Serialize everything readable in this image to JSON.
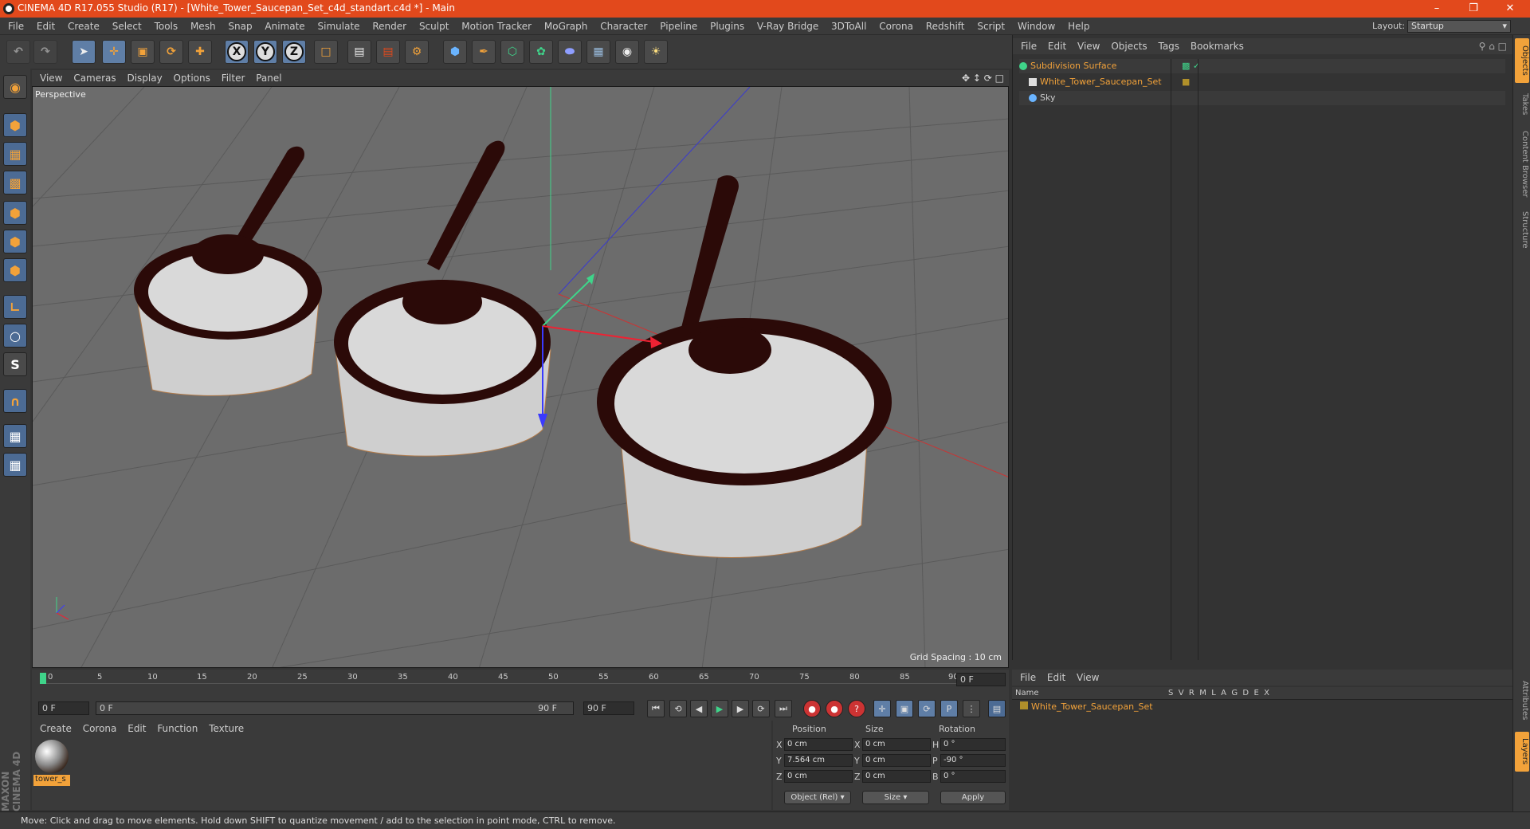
{
  "window": {
    "title": "CINEMA 4D R17.055 Studio (R17) - [White_Tower_Saucepan_Set_c4d_standart.c4d *] - Main"
  },
  "menu": [
    "File",
    "Edit",
    "Create",
    "Select",
    "Tools",
    "Mesh",
    "Snap",
    "Animate",
    "Simulate",
    "Render",
    "Sculpt",
    "Motion Tracker",
    "MoGraph",
    "Character",
    "Pipeline",
    "Plugins",
    "V-Ray Bridge",
    "3DToAll",
    "Corona",
    "Redshift",
    "Script",
    "Window",
    "Help"
  ],
  "layout": {
    "label": "Layout:",
    "value": "Startup"
  },
  "toolbar": {
    "x": "X",
    "y": "Y",
    "z": "Z"
  },
  "viewport": {
    "menu": [
      "View",
      "Cameras",
      "Display",
      "Options",
      "Filter",
      "Panel"
    ],
    "label": "Perspective",
    "grid": "Grid Spacing : 10 cm"
  },
  "timeline": {
    "ticks": [
      "0",
      "5",
      "10",
      "15",
      "20",
      "25",
      "30",
      "35",
      "40",
      "45",
      "50",
      "55",
      "60",
      "65",
      "70",
      "75",
      "80",
      "85",
      "90"
    ],
    "frame_end_field": "0 F",
    "start": "0 F",
    "range_start": "0 F",
    "range_end": "90 F",
    "end": "90 F"
  },
  "material": {
    "menu": [
      "Create",
      "Corona",
      "Edit",
      "Function",
      "Texture"
    ],
    "name": "tower_s"
  },
  "coords": {
    "headers": [
      "Position",
      "Size",
      "Rotation"
    ],
    "position": [
      {
        "axis": "X",
        "value": "0 cm"
      },
      {
        "axis": "Y",
        "value": "7.564 cm"
      },
      {
        "axis": "Z",
        "value": "0 cm"
      }
    ],
    "size": [
      {
        "axis": "X",
        "value": "0 cm"
      },
      {
        "axis": "Y",
        "value": "0 cm"
      },
      {
        "axis": "Z",
        "value": "0 cm"
      }
    ],
    "rotation": [
      {
        "axis": "H",
        "value": "0 °"
      },
      {
        "axis": "P",
        "value": "-90 °"
      },
      {
        "axis": "B",
        "value": "0 °"
      }
    ],
    "mode": "Object (Rel)",
    "size_mode": "Size",
    "apply": "Apply"
  },
  "objects": {
    "menu": [
      "File",
      "Edit",
      "View",
      "Objects",
      "Tags",
      "Bookmarks"
    ],
    "items": [
      {
        "name": "Subdivision Surface"
      },
      {
        "name": "White_Tower_Saucepan_Set"
      },
      {
        "name": "Sky"
      }
    ]
  },
  "layers": {
    "menu": [
      "File",
      "Edit",
      "View"
    ],
    "headers": {
      "name": "Name",
      "flags": "S  V  R  M  L  A  G  D  E  X"
    },
    "item": "White_Tower_Saucepan_Set"
  },
  "right_tabs": [
    "Objects",
    "Takes",
    "Content Browser",
    "Structure",
    "Attributes",
    "Layers"
  ],
  "status": "Move: Click and drag to move elements. Hold down SHIFT to quantize movement / add to the selection in point mode, CTRL to remove.",
  "brand": "MAXON CINEMA 4D",
  "colors": {
    "accent": "#f2a23a",
    "titlebar": "#e2491c",
    "viewport": "#6c6c6c"
  }
}
